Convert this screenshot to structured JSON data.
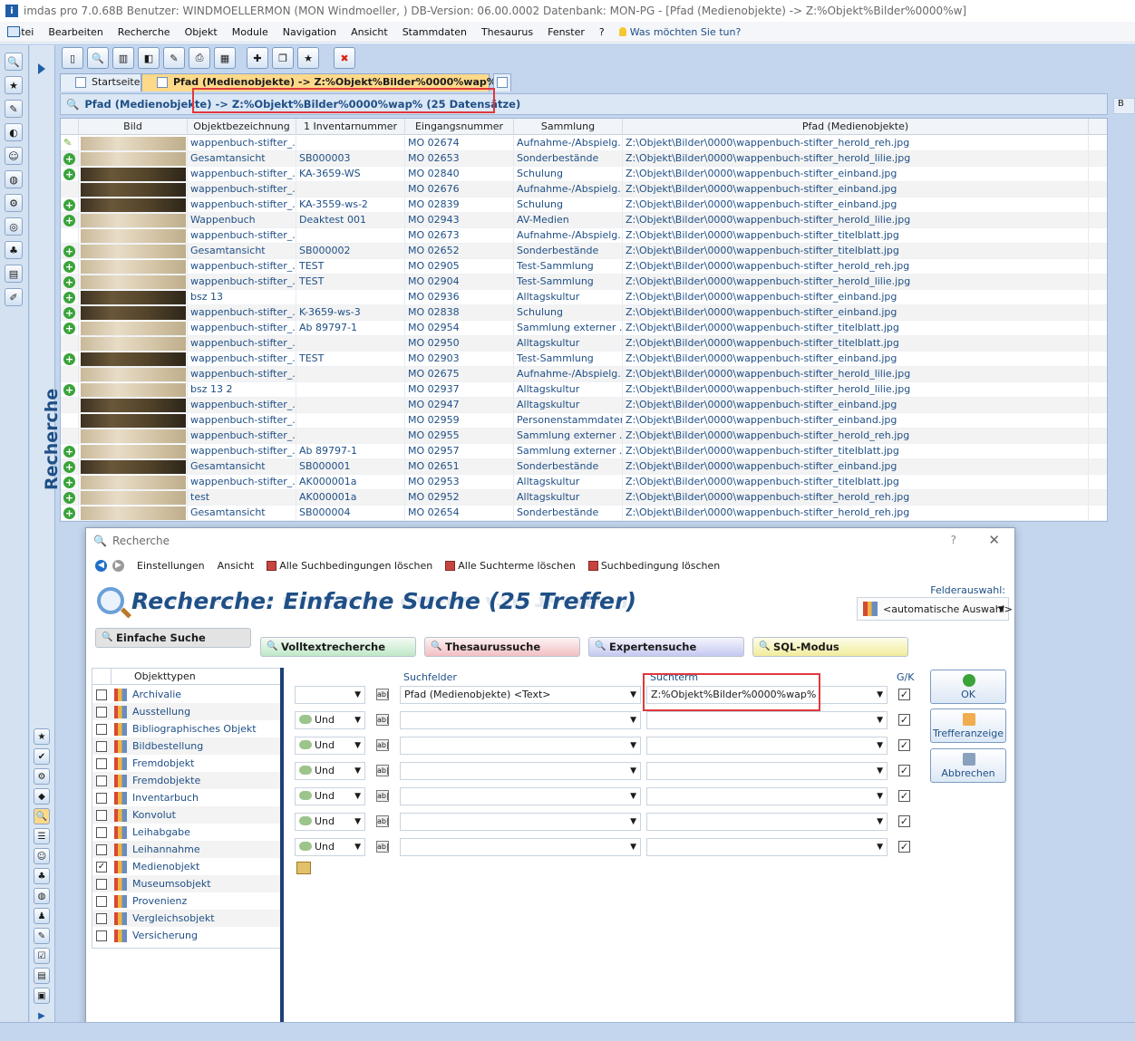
{
  "window": {
    "title": "imdas pro 7.0.68B Benutzer: WINDMOELLERMON (MON Windmoeller, )  DB-Version: 06.00.0002  Datenbank: MON-PG - [Pfad (Medienobjekte) -> Z:%Objekt%Bilder%0000%w]"
  },
  "menu": [
    "Datei",
    "Bearbeiten",
    "Recherche",
    "Objekt",
    "Module",
    "Navigation",
    "Ansicht",
    "Stammdaten",
    "Thesaurus",
    "Fenster",
    "?"
  ],
  "help_prompt": "Was möchten Sie tun?",
  "sidebar": {
    "vertical_label": "Recherche"
  },
  "tabs": [
    {
      "label": "Startseite",
      "active": false
    },
    {
      "label": "Pfad (Medienobjekte) -> Z:%Objekt%Bilder%0000%wap%",
      "active": true
    }
  ],
  "grid": {
    "header": "Pfad (Medienobjekte) -> Z:%Objekt%Bilder%0000%wap% (25 Datensätze)",
    "right_corner": "B",
    "columns": [
      "Bild",
      "Objektbezeichnung",
      "1 Inventarnummer",
      "Eingangsnummer",
      "Sammlung",
      "Pfad (Medienobjekte)"
    ],
    "rows": [
      {
        "marker": "pen",
        "thumb": "light",
        "name": "wappenbuch-stifter_...",
        "inv": "",
        "eingang": "MO 02674",
        "sammlung": "Aufnahme-/Abspielg...",
        "pfad": "Z:\\Objekt\\Bilder\\0000\\wappenbuch-stifter_herold_reh.jpg"
      },
      {
        "marker": "plus",
        "thumb": "light",
        "name": "Gesamtansicht",
        "inv": "SB000003",
        "eingang": "MO 02653",
        "sammlung": "Sonderbestände",
        "pfad": "Z:\\Objekt\\Bilder\\0000\\wappenbuch-stifter_herold_lilie.jpg"
      },
      {
        "marker": "plus",
        "thumb": "dark",
        "name": "wappenbuch-stifter_...",
        "inv": "KA-3659-WS",
        "eingang": "MO 02840",
        "sammlung": "Schulung",
        "pfad": "Z:\\Objekt\\Bilder\\0000\\wappenbuch-stifter_einband.jpg"
      },
      {
        "marker": "",
        "thumb": "dark",
        "name": "wappenbuch-stifter_...",
        "inv": "",
        "eingang": "MO 02676",
        "sammlung": "Aufnahme-/Abspielg...",
        "pfad": "Z:\\Objekt\\Bilder\\0000\\wappenbuch-stifter_einband.jpg"
      },
      {
        "marker": "plus",
        "thumb": "dark",
        "name": "wappenbuch-stifter_...",
        "inv": "KA-3559-ws-2",
        "eingang": "MO 02839",
        "sammlung": "Schulung",
        "pfad": "Z:\\Objekt\\Bilder\\0000\\wappenbuch-stifter_einband.jpg"
      },
      {
        "marker": "plus",
        "thumb": "light",
        "name": "Wappenbuch",
        "inv": "Deaktest 001",
        "eingang": "MO 02943",
        "sammlung": "AV-Medien",
        "pfad": "Z:\\Objekt\\Bilder\\0000\\wappenbuch-stifter_herold_lilie.jpg"
      },
      {
        "marker": "",
        "thumb": "light",
        "name": "wappenbuch-stifter_...",
        "inv": "",
        "eingang": "MO 02673",
        "sammlung": "Aufnahme-/Abspielg...",
        "pfad": "Z:\\Objekt\\Bilder\\0000\\wappenbuch-stifter_titelblatt.jpg"
      },
      {
        "marker": "plus",
        "thumb": "light",
        "name": "Gesamtansicht",
        "inv": "SB000002",
        "eingang": "MO 02652",
        "sammlung": "Sonderbestände",
        "pfad": "Z:\\Objekt\\Bilder\\0000\\wappenbuch-stifter_titelblatt.jpg"
      },
      {
        "marker": "plus",
        "thumb": "light",
        "name": "wappenbuch-stifter_...",
        "inv": "TEST",
        "eingang": "MO 02905",
        "sammlung": "Test-Sammlung",
        "pfad": "Z:\\Objekt\\Bilder\\0000\\wappenbuch-stifter_herold_reh.jpg"
      },
      {
        "marker": "plus",
        "thumb": "light",
        "name": "wappenbuch-stifter_...",
        "inv": "TEST",
        "eingang": "MO 02904",
        "sammlung": "Test-Sammlung",
        "pfad": "Z:\\Objekt\\Bilder\\0000\\wappenbuch-stifter_herold_lilie.jpg"
      },
      {
        "marker": "plus",
        "thumb": "dark",
        "name": "bsz 13",
        "inv": "",
        "eingang": "MO 02936",
        "sammlung": "Alltagskultur",
        "pfad": "Z:\\Objekt\\Bilder\\0000\\wappenbuch-stifter_einband.jpg"
      },
      {
        "marker": "plus",
        "thumb": "dark",
        "name": "wappenbuch-stifter_...",
        "inv": "K-3659-ws-3",
        "eingang": "MO 02838",
        "sammlung": "Schulung",
        "pfad": "Z:\\Objekt\\Bilder\\0000\\wappenbuch-stifter_einband.jpg"
      },
      {
        "marker": "plus",
        "thumb": "light",
        "name": "wappenbuch-stifter_...",
        "inv": "Ab 89797-1",
        "eingang": "MO 02954",
        "sammlung": "Sammlung externer ...",
        "pfad": "Z:\\Objekt\\Bilder\\0000\\wappenbuch-stifter_titelblatt.jpg"
      },
      {
        "marker": "",
        "thumb": "light",
        "name": "wappenbuch-stifter_...",
        "inv": "",
        "eingang": "MO 02950",
        "sammlung": "Alltagskultur",
        "pfad": "Z:\\Objekt\\Bilder\\0000\\wappenbuch-stifter_titelblatt.jpg"
      },
      {
        "marker": "plus",
        "thumb": "dark",
        "name": "wappenbuch-stifter_...",
        "inv": "TEST",
        "eingang": "MO 02903",
        "sammlung": "Test-Sammlung",
        "pfad": "Z:\\Objekt\\Bilder\\0000\\wappenbuch-stifter_einband.jpg"
      },
      {
        "marker": "",
        "thumb": "light",
        "name": "wappenbuch-stifter_...",
        "inv": "",
        "eingang": "MO 02675",
        "sammlung": "Aufnahme-/Abspielg...",
        "pfad": "Z:\\Objekt\\Bilder\\0000\\wappenbuch-stifter_herold_lilie.jpg"
      },
      {
        "marker": "plus",
        "thumb": "light",
        "name": "bsz 13 2",
        "inv": "",
        "eingang": "MO 02937",
        "sammlung": "Alltagskultur",
        "pfad": "Z:\\Objekt\\Bilder\\0000\\wappenbuch-stifter_herold_lilie.jpg"
      },
      {
        "marker": "",
        "thumb": "dark",
        "name": "wappenbuch-stifter_...",
        "inv": "",
        "eingang": "MO 02947",
        "sammlung": "Alltagskultur",
        "pfad": "Z:\\Objekt\\Bilder\\0000\\wappenbuch-stifter_einband.jpg"
      },
      {
        "marker": "",
        "thumb": "dark",
        "name": "wappenbuch-stifter_...",
        "inv": "",
        "eingang": "MO 02959",
        "sammlung": "Personenstammdaten",
        "pfad": "Z:\\Objekt\\Bilder\\0000\\wappenbuch-stifter_einband.jpg"
      },
      {
        "marker": "",
        "thumb": "light",
        "name": "wappenbuch-stifter_...",
        "inv": "",
        "eingang": "MO 02955",
        "sammlung": "Sammlung externer ...",
        "pfad": "Z:\\Objekt\\Bilder\\0000\\wappenbuch-stifter_herold_reh.jpg"
      },
      {
        "marker": "plus",
        "thumb": "light",
        "name": "wappenbuch-stifter_...",
        "inv": "Ab 89797-1",
        "eingang": "MO 02957",
        "sammlung": "Sammlung externer ...",
        "pfad": "Z:\\Objekt\\Bilder\\0000\\wappenbuch-stifter_titelblatt.jpg"
      },
      {
        "marker": "plus",
        "thumb": "dark",
        "name": "Gesamtansicht",
        "inv": "SB000001",
        "eingang": "MO 02651",
        "sammlung": "Sonderbestände",
        "pfad": "Z:\\Objekt\\Bilder\\0000\\wappenbuch-stifter_einband.jpg"
      },
      {
        "marker": "plus",
        "thumb": "light",
        "name": "wappenbuch-stifter_...",
        "inv": "AK000001a",
        "eingang": "MO 02953",
        "sammlung": "Alltagskultur",
        "pfad": "Z:\\Objekt\\Bilder\\0000\\wappenbuch-stifter_titelblatt.jpg"
      },
      {
        "marker": "plus",
        "thumb": "light",
        "name": "test",
        "inv": "AK000001a",
        "eingang": "MO 02952",
        "sammlung": "Alltagskultur",
        "pfad": "Z:\\Objekt\\Bilder\\0000\\wappenbuch-stifter_herold_reh.jpg"
      },
      {
        "marker": "plus",
        "thumb": "light",
        "name": "Gesamtansicht",
        "inv": "SB000004",
        "eingang": "MO 02654",
        "sammlung": "Sonderbestände",
        "pfad": "Z:\\Objekt\\Bilder\\0000\\wappenbuch-stifter_herold_reh.jpg"
      }
    ]
  },
  "dialog": {
    "title": "Recherche",
    "help": "?",
    "close": "✕",
    "menu": [
      "Einstellungen",
      "Ansicht",
      "Alle Suchbedingungen löschen",
      "Alle Suchterme löschen",
      "Suchbedingung löschen"
    ],
    "heading": "Recherche: Einfache Suche (25 Treffer)",
    "felderauswahl_label": "Felderauswahl:",
    "felderauswahl_value": "<automatische Auswahl>",
    "modes": [
      "Einfache Suche",
      "Volltextrecherche",
      "Thesaurussuche",
      "Expertensuche",
      "SQL-Modus"
    ],
    "objekttypen_header": "Objekttypen",
    "objekttypen": [
      {
        "label": "Archivalie",
        "checked": false
      },
      {
        "label": "Ausstellung",
        "checked": false
      },
      {
        "label": "Bibliographisches Objekt",
        "checked": false
      },
      {
        "label": "Bildbestellung",
        "checked": false
      },
      {
        "label": "Fremdobjekt",
        "checked": false
      },
      {
        "label": "Fremdobjekte",
        "checked": false
      },
      {
        "label": "Inventarbuch",
        "checked": false
      },
      {
        "label": "Konvolut",
        "checked": false
      },
      {
        "label": "Leihabgabe",
        "checked": false
      },
      {
        "label": "Leihannahme",
        "checked": false
      },
      {
        "label": "Medienobjekt",
        "checked": true
      },
      {
        "label": "Museumsobjekt",
        "checked": false
      },
      {
        "label": "Provenienz",
        "checked": false
      },
      {
        "label": "Vergleichsobjekt",
        "checked": false
      },
      {
        "label": "Versicherung",
        "checked": false
      }
    ],
    "suchfelder_label": "Suchfelder",
    "suchterm_label": "Suchterm",
    "gk_label": "G/K",
    "ab_label": "ab|",
    "conditions": [
      {
        "op": "",
        "field": "Pfad (Medienobjekte) <Text>",
        "term": "Z:%Objekt%Bilder%0000%wap%",
        "gk": true
      },
      {
        "op": "Und",
        "field": "",
        "term": "",
        "gk": true
      },
      {
        "op": "Und",
        "field": "",
        "term": "",
        "gk": true
      },
      {
        "op": "Und",
        "field": "",
        "term": "",
        "gk": true
      },
      {
        "op": "Und",
        "field": "",
        "term": "",
        "gk": true
      },
      {
        "op": "Und",
        "field": "",
        "term": "",
        "gk": true
      },
      {
        "op": "Und",
        "field": "",
        "term": "",
        "gk": true
      }
    ],
    "buttons": {
      "ok": "OK",
      "treffer": "Trefferanzeige",
      "abbrechen": "Abbrechen"
    }
  }
}
